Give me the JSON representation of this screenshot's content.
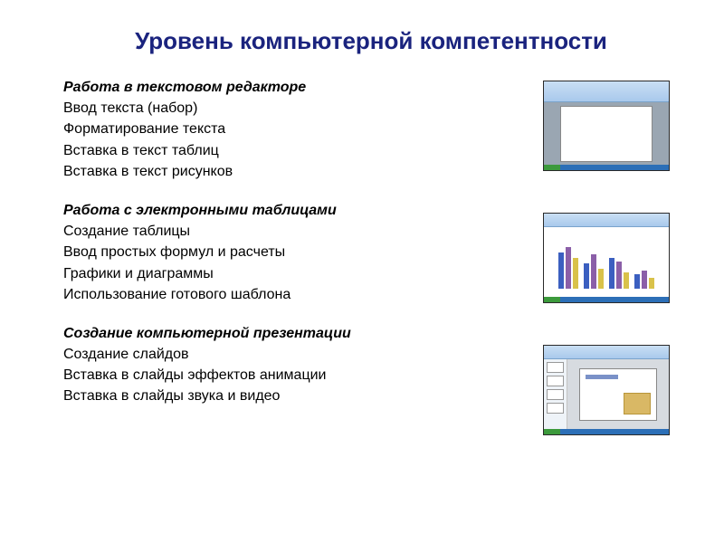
{
  "title": "Уровень компьютерной компетентности",
  "sections": [
    {
      "heading": "Работа в текстовом редакторе",
      "items": [
        "Ввод текста (набор)",
        "Форматирование текста",
        "Вставка в текст таблиц",
        "Вставка в текст рисунков"
      ],
      "thumb": "word"
    },
    {
      "heading": "Работа с электронными таблицами",
      "items": [
        "Создание таблицы",
        "Ввод простых формул и расчеты",
        "Графики и диаграммы",
        "Использование готового шаблона"
      ],
      "thumb": "excel"
    },
    {
      "heading": "Создание компьютерной презентации",
      "items": [
        "Создание слайдов",
        "Вставка в слайды эффектов анимации",
        "Вставка в слайды звука и видео"
      ],
      "thumb": "powerpoint"
    }
  ]
}
